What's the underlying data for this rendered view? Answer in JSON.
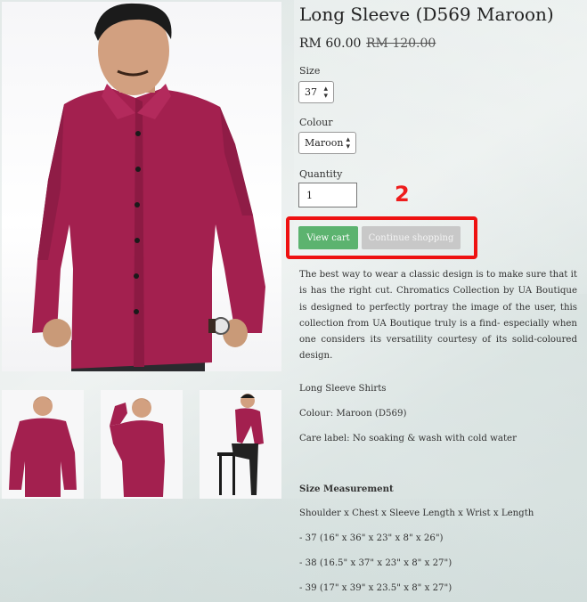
{
  "product": {
    "title": "Long Sleeve (D569 Maroon)",
    "price": "RM 60.00",
    "old_price": "RM 120.00",
    "size_label": "Size",
    "size_value": "37",
    "colour_label": "Colour",
    "colour_value": "Maroon",
    "quantity_label": "Quantity",
    "quantity_value": "1"
  },
  "annotation": {
    "number": "2",
    "color": "#ee1111"
  },
  "buttons": {
    "view_cart": "View cart",
    "continue_shopping": "Continue shopping"
  },
  "description": "The best way to wear a classic design is to make sure that it is has the right cut. Chromatics Collection by UA Boutique is designed to perfectly portray the image of the user, this collection from UA Boutique truly is a find- especially when one considers its versatility courtesy of its solid-coloured design.",
  "details": {
    "category": "Long Sleeve Shirts",
    "colour": "Colour: Maroon (D569)",
    "care": "Care label: No soaking & wash with cold water"
  },
  "size_measurement": {
    "heading": "Size Measurement",
    "format": "Shoulder x Chest x Sleeve Length x Wrist x Length",
    "rows": [
      "- 37 (16\" x 36\" x 23\" x 8\" x 26\")",
      "- 38 (16.5\" x 37\" x 23\" x 8\" x 27\")",
      "- 39 (17\" x 39\" x 23.5\" x 8\" x 27\")"
    ]
  },
  "colors": {
    "shirt": "#a3204f",
    "view_cart_bg": "#5cb36f",
    "continue_bg": "#c8c8c8"
  }
}
